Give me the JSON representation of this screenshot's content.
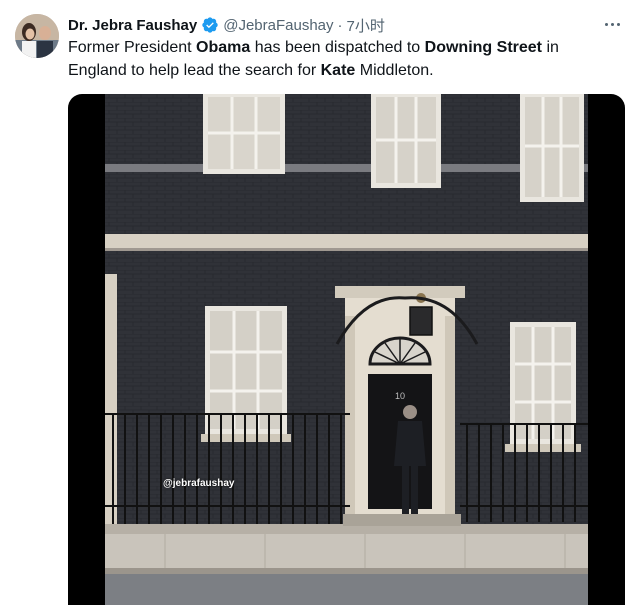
{
  "author": {
    "name": "Dr. Jebra Faushay",
    "handle": "@JebraFaushay",
    "separator": "·",
    "time": "7小时",
    "avatar_icon": "profile-photo-avatar",
    "verified_icon": "verified-badge-icon"
  },
  "tweet": {
    "p1": "Former President ",
    "b1": "Obama",
    "p2": " has been dispatched to ",
    "b2": "Downing Street",
    "p3": " in England to help lead the search for ",
    "b3": "Kate",
    "p4": " Middleton."
  },
  "media": {
    "door_number": "10",
    "watermark": "@jebrafaushay"
  },
  "colors": {
    "verified": "#1d9bf0",
    "text": "#0f1419",
    "secondary": "#536471",
    "brick": "#2f3136"
  }
}
